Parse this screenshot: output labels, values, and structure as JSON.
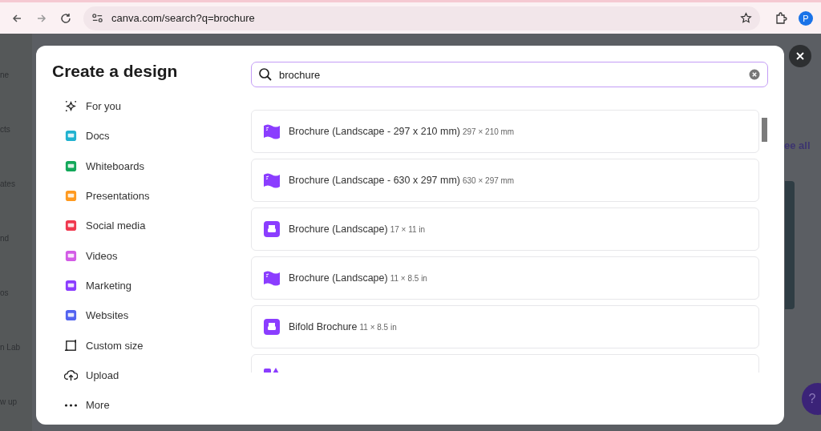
{
  "browser": {
    "url": "canva.com/search?q=brochure",
    "profile": "P"
  },
  "background": {
    "sidebar_labels": [
      "ne",
      "cts",
      "ates",
      "nd",
      "os",
      "n Lab",
      "w up"
    ],
    "see_all": "ee all",
    "help": "?"
  },
  "modal": {
    "title": "Create a design",
    "categories": [
      {
        "label": "For you",
        "kind": "sparkle"
      },
      {
        "label": "Docs",
        "kind": "docs"
      },
      {
        "label": "Whiteboards",
        "kind": "whiteboard"
      },
      {
        "label": "Presentations",
        "kind": "presentation"
      },
      {
        "label": "Social media",
        "kind": "social"
      },
      {
        "label": "Videos",
        "kind": "video"
      },
      {
        "label": "Marketing",
        "kind": "marketing"
      },
      {
        "label": "Websites",
        "kind": "website"
      },
      {
        "label": "Custom size",
        "kind": "custom"
      },
      {
        "label": "Upload",
        "kind": "upload"
      },
      {
        "label": "More",
        "kind": "more"
      }
    ],
    "search": {
      "value": "brochure"
    },
    "results": [
      {
        "name": "Brochure (Landscape - 297 x 210 mm)",
        "size": "297 × 210 mm",
        "kind": "brochure"
      },
      {
        "name": "Brochure (Landscape - 630 x 297 mm)",
        "size": "630 × 297 mm",
        "kind": "brochure"
      },
      {
        "name": "Brochure (Landscape)",
        "size": "17 × 11 in",
        "kind": "print"
      },
      {
        "name": "Brochure (Landscape)",
        "size": "11 × 8.5 in",
        "kind": "brochure"
      },
      {
        "name": "Bifold Brochure",
        "size": "11 × 8.5 in",
        "kind": "print"
      }
    ]
  }
}
